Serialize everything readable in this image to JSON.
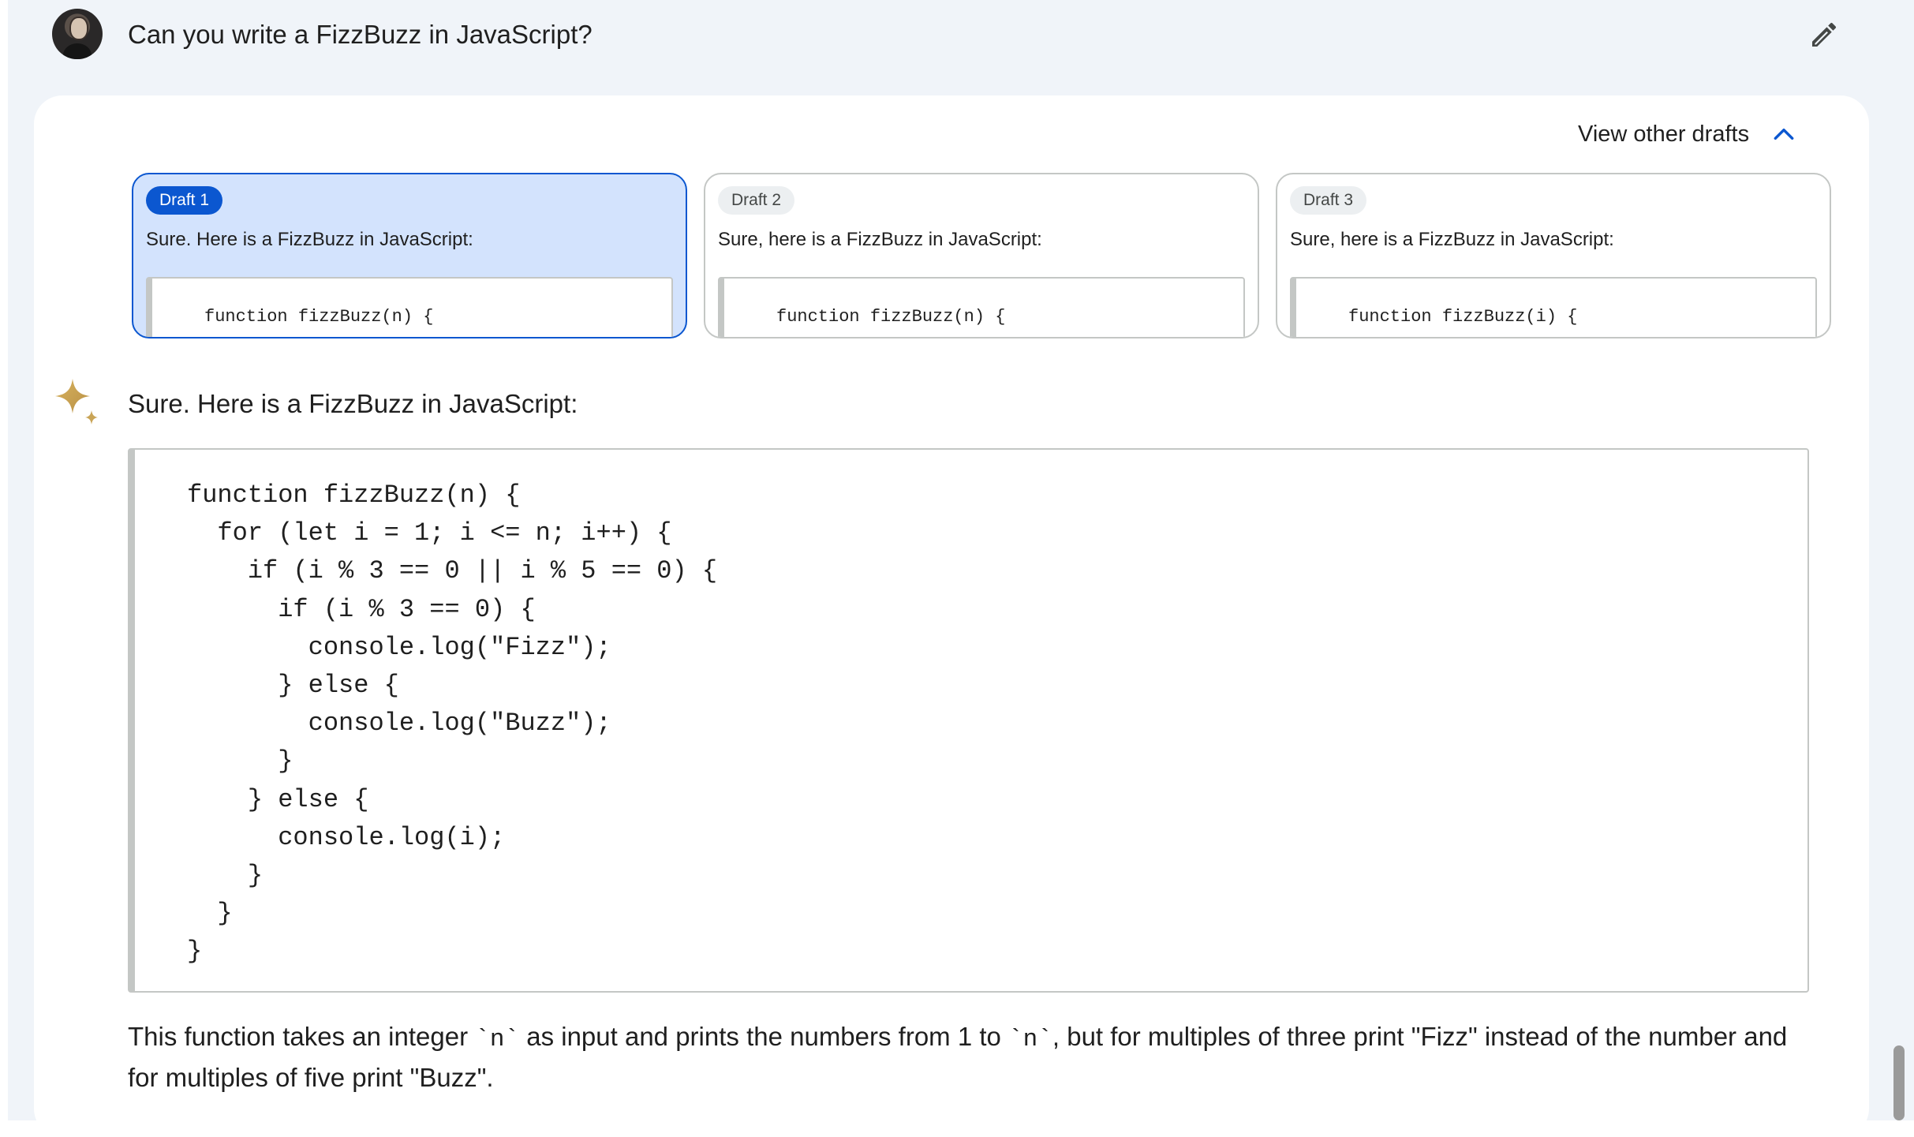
{
  "prompt": {
    "text": "Can you write a FizzBuzz in JavaScript?",
    "edit_icon": "pencil-icon"
  },
  "drafts_toggle": {
    "label": "View other drafts",
    "icon": "chevron-up-icon"
  },
  "drafts": [
    {
      "badge": "Draft 1",
      "text": "Sure. Here is a FizzBuzz in JavaScript:",
      "code": "function fizzBuzz(n) {",
      "selected": true
    },
    {
      "badge": "Draft 2",
      "text": "Sure, here is a FizzBuzz in JavaScript:",
      "code": "function fizzBuzz(n) {",
      "selected": false
    },
    {
      "badge": "Draft 3",
      "text": "Sure, here is a FizzBuzz in JavaScript:",
      "code": "function fizzBuzz(i) {",
      "selected": false
    }
  ],
  "response": {
    "icon": "sparkle-icon",
    "intro": "Sure. Here is a FizzBuzz in JavaScript:",
    "code_lines": [
      "function fizzBuzz(n) {",
      "  for (let i = 1; i <= n; i++) {",
      "    if (i % 3 == 0 || i % 5 == 0) {",
      "      if (i % 3 == 0) {",
      "        console.log(\"Fizz\");",
      "      } else {",
      "        console.log(\"Buzz\");",
      "      }",
      "    } else {",
      "      console.log(i);",
      "    }",
      "  }",
      "}"
    ],
    "explanation": {
      "part1": "This function takes an integer ",
      "code1": "`n`",
      "part2": " as input and prints the numbers from 1 to ",
      "code2": "`n`",
      "part3": ", but for multiples of three print \"Fizz\" instead of the number and for multiples of five print \"Buzz\"."
    }
  },
  "colors": {
    "accent": "#0b57d0",
    "selected_draft_bg": "#d3e3fd",
    "page_bg": "#f0f4f9"
  }
}
